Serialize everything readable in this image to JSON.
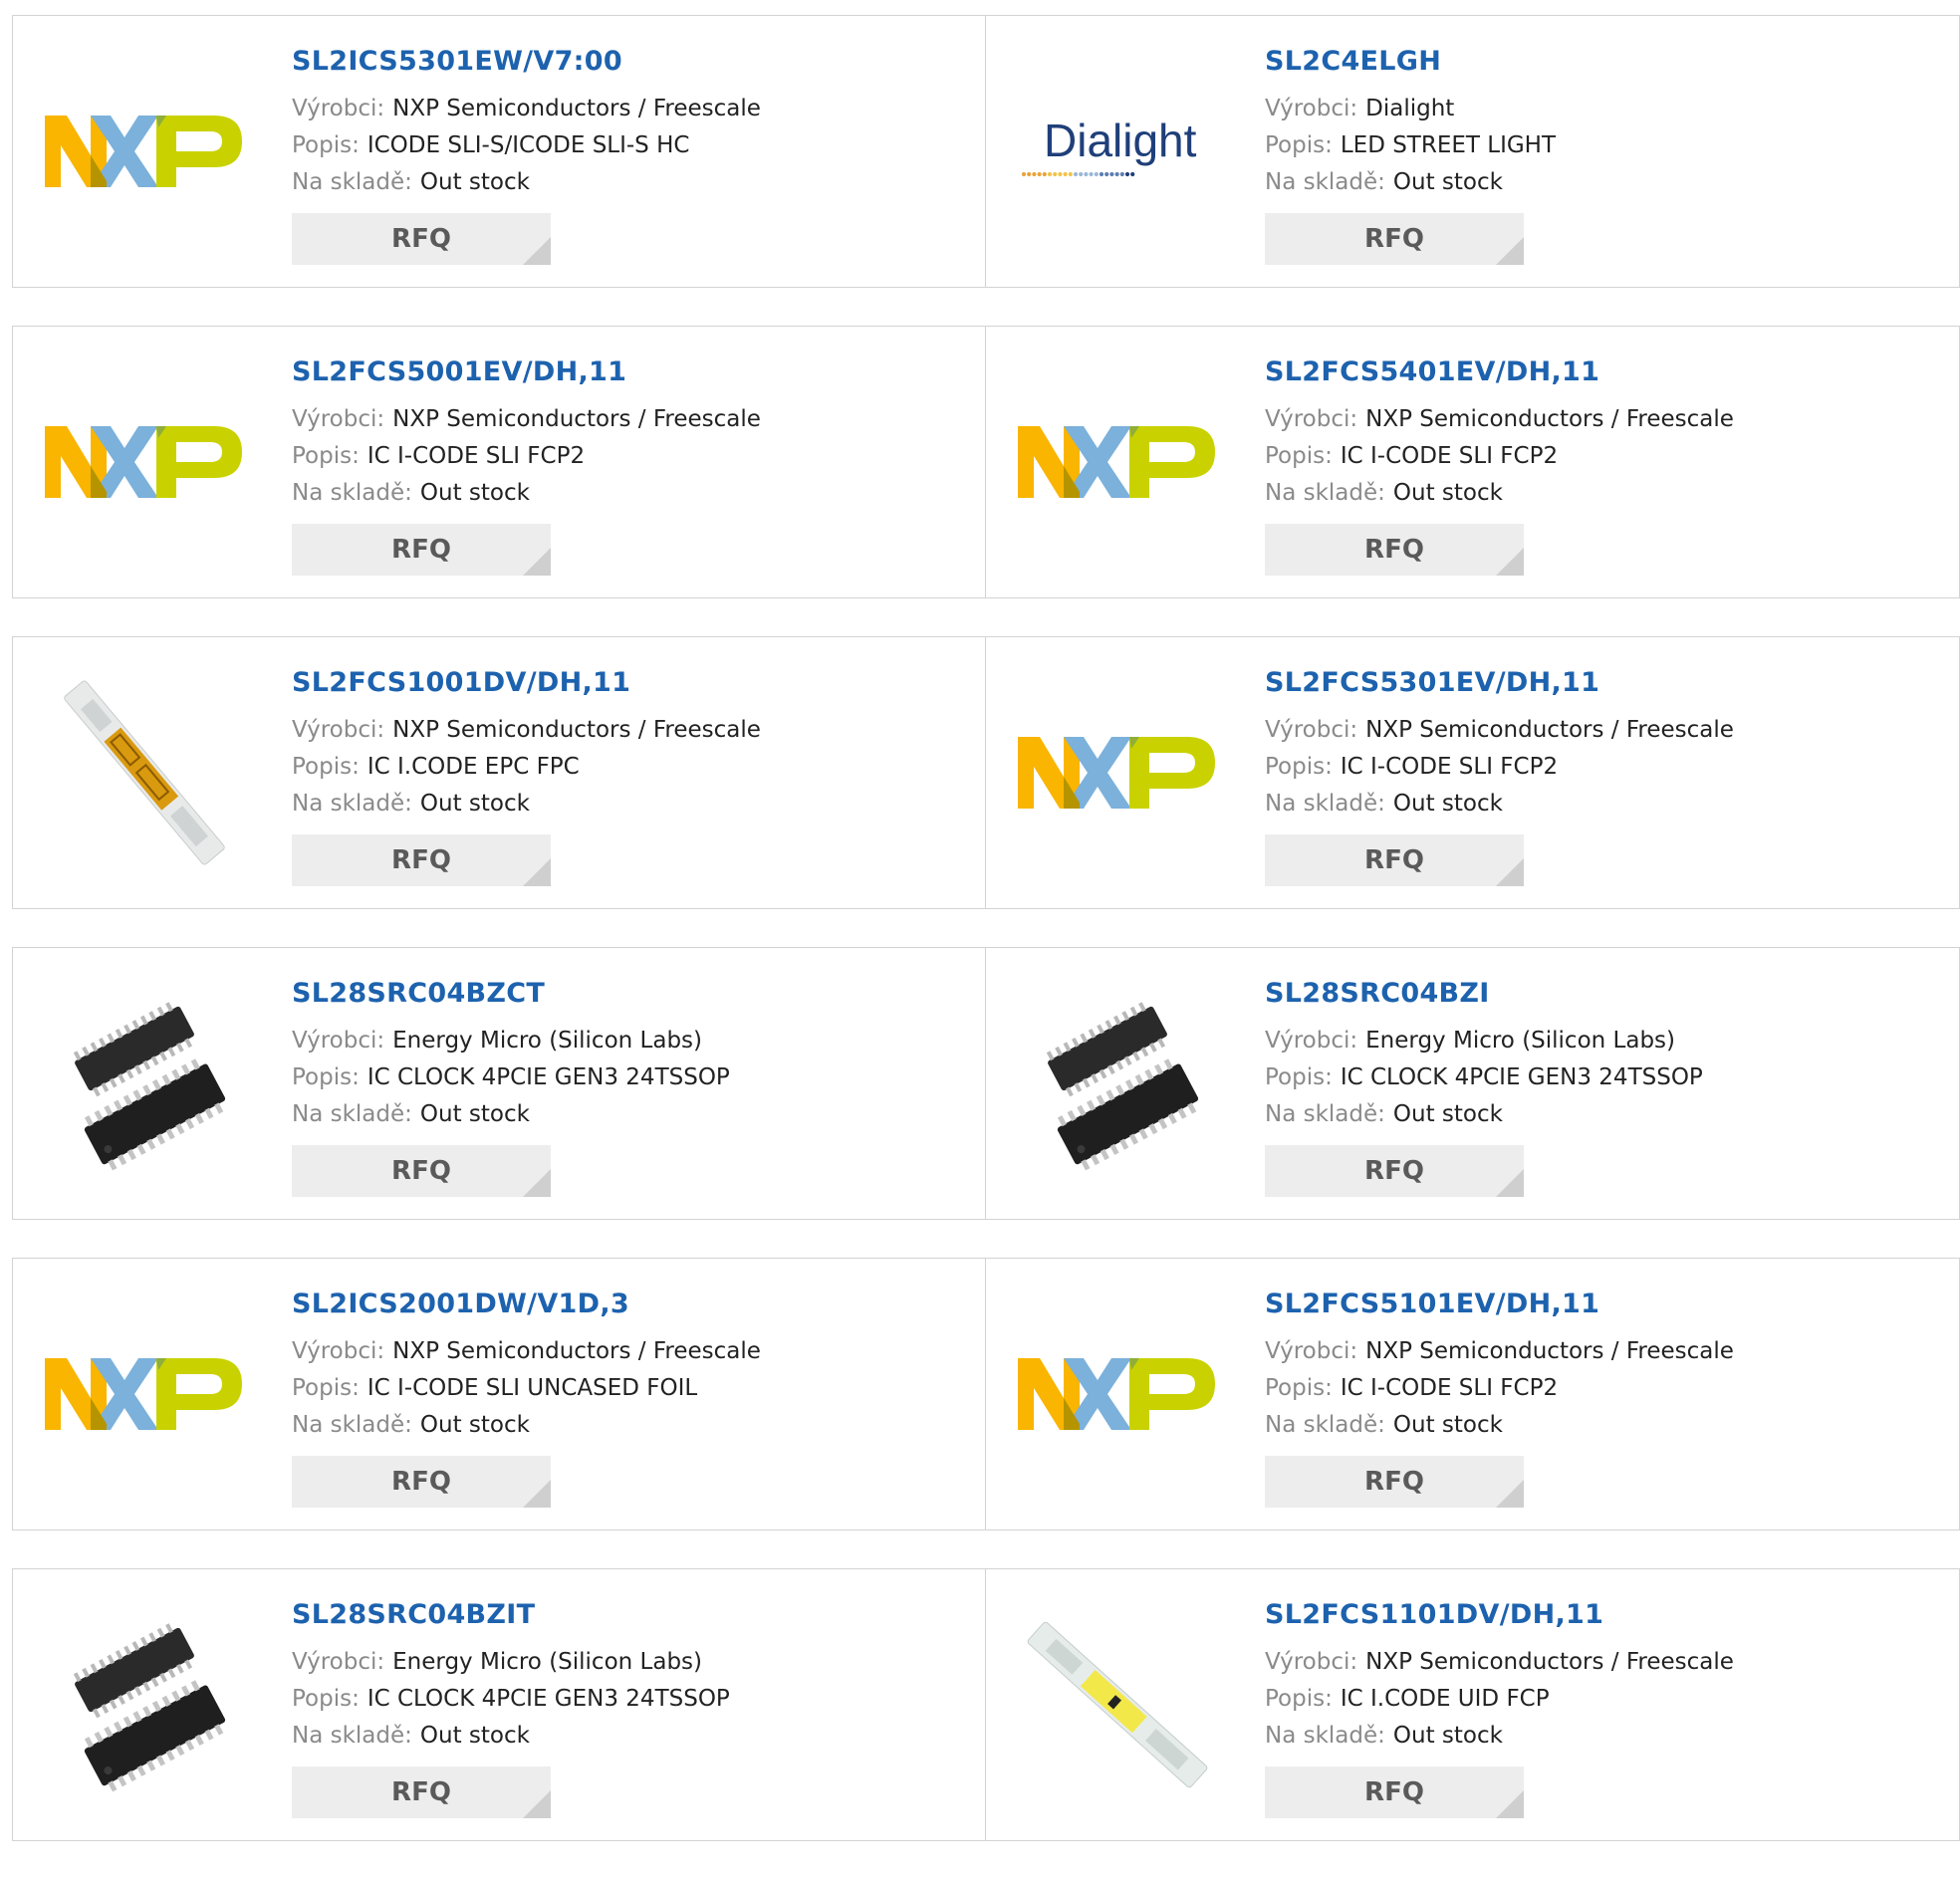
{
  "labels": {
    "manufacturer": "Výrobci:",
    "description": "Popis:",
    "stock": "Na skladě:"
  },
  "products": [
    {
      "part": "SL2ICS5301EW/V7:00",
      "manufacturer": "NXP Semiconductors / Freescale",
      "description": "ICODE SLI-S/ICODE SLI-S HC",
      "stock": "Out stock",
      "image": "nxp-logo",
      "button": "RFQ"
    },
    {
      "part": "SL2C4ELGH",
      "manufacturer": "Dialight",
      "description": "LED STREET LIGHT",
      "stock": "Out stock",
      "image": "dialight-logo",
      "logo_text": "Dialight",
      "button": "RFQ"
    },
    {
      "part": "SL2FCS5001EV/DH,11",
      "manufacturer": "NXP Semiconductors / Freescale",
      "description": "IC I-CODE SLI FCP2",
      "stock": "Out stock",
      "image": "nxp-logo",
      "button": "RFQ"
    },
    {
      "part": "SL2FCS5401EV/DH,11",
      "manufacturer": "NXP Semiconductors / Freescale",
      "description": "IC I-CODE SLI FCP2",
      "stock": "Out stock",
      "image": "nxp-logo",
      "button": "RFQ"
    },
    {
      "part": "SL2FCS1001DV/DH,11",
      "manufacturer": "NXP Semiconductors / Freescale",
      "description": "IC I.CODE EPC FPC",
      "stock": "Out stock",
      "image": "rfid-strip-orange",
      "button": "RFQ"
    },
    {
      "part": "SL2FCS5301EV/DH,11",
      "manufacturer": "NXP Semiconductors / Freescale",
      "description": "IC I-CODE SLI FCP2",
      "stock": "Out stock",
      "image": "nxp-logo",
      "button": "RFQ"
    },
    {
      "part": "SL28SRC04BZCT",
      "manufacturer": "Energy Micro (Silicon Labs)",
      "description": "IC CLOCK 4PCIE GEN3 24TSSOP",
      "stock": "Out stock",
      "image": "tssop-chips",
      "button": "RFQ"
    },
    {
      "part": "SL28SRC04BZI",
      "manufacturer": "Energy Micro (Silicon Labs)",
      "description": "IC CLOCK 4PCIE GEN3 24TSSOP",
      "stock": "Out stock",
      "image": "tssop-chips",
      "button": "RFQ"
    },
    {
      "part": "SL2ICS2001DW/V1D,3",
      "manufacturer": "NXP Semiconductors / Freescale",
      "description": "IC I-CODE SLI UNCASED FOIL",
      "stock": "Out stock",
      "image": "nxp-logo",
      "button": "RFQ"
    },
    {
      "part": "SL2FCS5101EV/DH,11",
      "manufacturer": "NXP Semiconductors / Freescale",
      "description": "IC I-CODE SLI FCP2",
      "stock": "Out stock",
      "image": "nxp-logo",
      "button": "RFQ"
    },
    {
      "part": "SL28SRC04BZIT",
      "manufacturer": "Energy Micro (Silicon Labs)",
      "description": "IC CLOCK 4PCIE GEN3 24TSSOP",
      "stock": "Out stock",
      "image": "tssop-chips",
      "button": "RFQ"
    },
    {
      "part": "SL2FCS1101DV/DH,11",
      "manufacturer": "NXP Semiconductors / Freescale",
      "description": "IC I.CODE UID FCP",
      "stock": "Out stock",
      "image": "rfid-strip-yellow",
      "button": "RFQ"
    }
  ],
  "colors": {
    "title": "#1d62ae",
    "nxp_orange": "#f9b500",
    "nxp_blue": "#7bb1db",
    "nxp_green": "#c9d200"
  }
}
